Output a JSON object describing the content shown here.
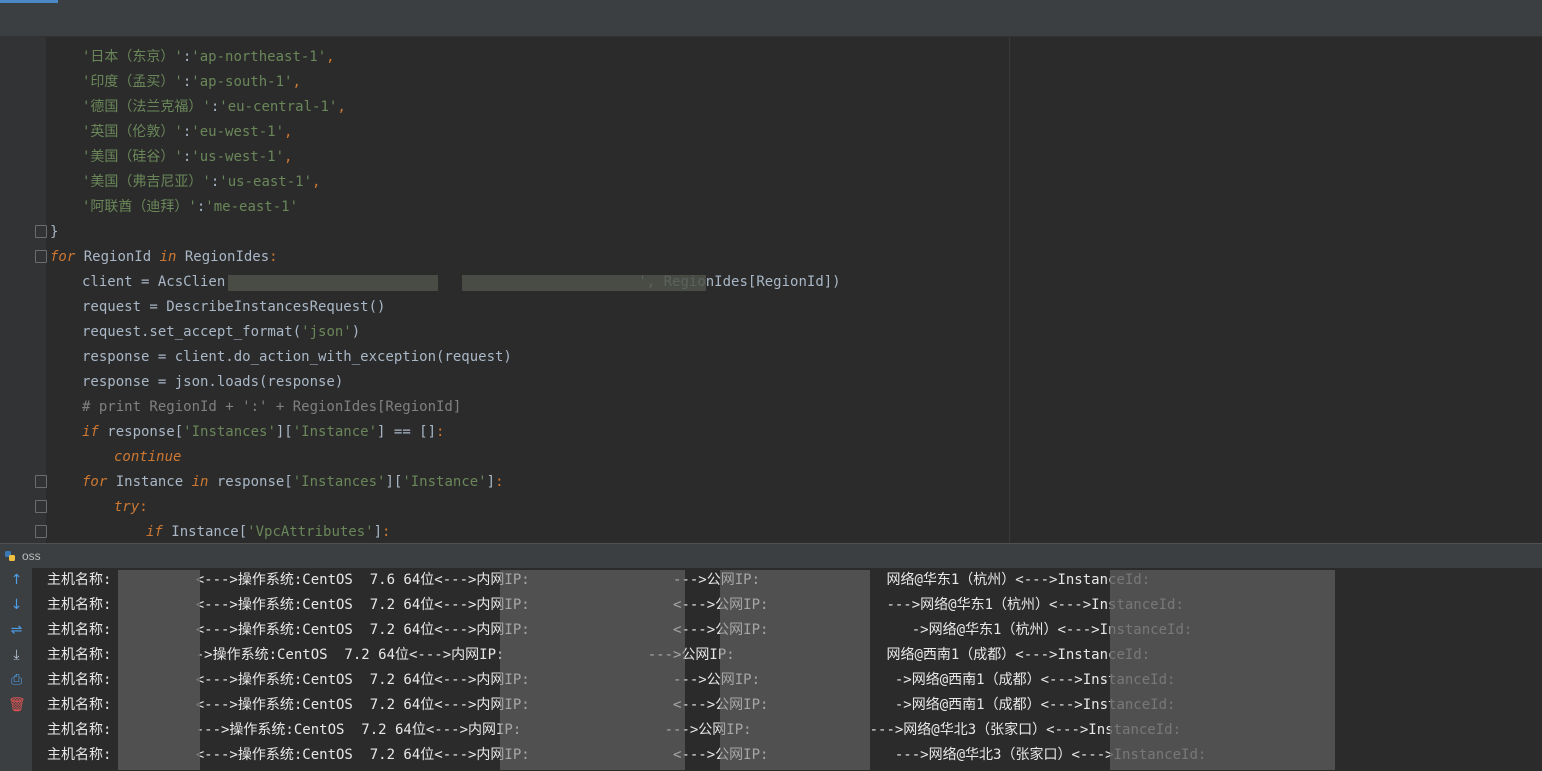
{
  "editor": {
    "lines": [
      {
        "indent": 2,
        "parts": [
          {
            "t": "'日本（东京）'",
            "c": "str"
          },
          {
            "t": ":",
            "c": ""
          },
          {
            "t": "'ap-northeast-1'",
            "c": "str"
          },
          {
            "t": ",",
            "c": "kw2"
          }
        ]
      },
      {
        "indent": 2,
        "parts": [
          {
            "t": "'印度（孟买）'",
            "c": "str"
          },
          {
            "t": ":",
            "c": ""
          },
          {
            "t": "'ap-south-1'",
            "c": "str"
          },
          {
            "t": ",",
            "c": "kw2"
          }
        ]
      },
      {
        "indent": 2,
        "parts": [
          {
            "t": "'德国（法兰克福）'",
            "c": "str"
          },
          {
            "t": ":",
            "c": ""
          },
          {
            "t": "'eu-central-1'",
            "c": "str"
          },
          {
            "t": ",",
            "c": "kw2"
          }
        ]
      },
      {
        "indent": 2,
        "parts": [
          {
            "t": "'英国（伦敦）'",
            "c": "str"
          },
          {
            "t": ":",
            "c": ""
          },
          {
            "t": "'eu-west-1'",
            "c": "str"
          },
          {
            "t": ",",
            "c": "kw2"
          }
        ]
      },
      {
        "indent": 2,
        "parts": [
          {
            "t": "'美国（硅谷）'",
            "c": "str"
          },
          {
            "t": ":",
            "c": ""
          },
          {
            "t": "'us-west-1'",
            "c": "str"
          },
          {
            "t": ",",
            "c": "kw2"
          }
        ]
      },
      {
        "indent": 2,
        "parts": [
          {
            "t": "'美国（弗吉尼亚）'",
            "c": "str"
          },
          {
            "t": ":",
            "c": ""
          },
          {
            "t": "'us-east-1'",
            "c": "str"
          },
          {
            "t": ",",
            "c": "kw2"
          }
        ]
      },
      {
        "indent": 2,
        "parts": [
          {
            "t": "'阿联酋（迪拜）'",
            "c": "str"
          },
          {
            "t": ":",
            "c": ""
          },
          {
            "t": "'me-east-1'",
            "c": "str"
          }
        ]
      },
      {
        "indent": 0,
        "parts": [
          {
            "t": "}",
            "c": ""
          }
        ]
      },
      {
        "indent": 0,
        "parts": [
          {
            "t": "for",
            "c": "kw"
          },
          {
            "t": " RegionId ",
            "c": ""
          },
          {
            "t": "in",
            "c": "kw"
          },
          {
            "t": " RegionIdes",
            "c": ""
          },
          {
            "t": ":",
            "c": "kw2"
          }
        ]
      },
      {
        "indent": 2,
        "parts": [
          {
            "t": "client = AcsClien",
            "c": ""
          },
          {
            "t": "                                                 ",
            "c": ""
          },
          {
            "t": "', RegionIdes[RegionId])",
            "c": ""
          }
        ]
      },
      {
        "indent": 2,
        "parts": [
          {
            "t": "request = DescribeInstancesRequest()",
            "c": ""
          }
        ]
      },
      {
        "indent": 2,
        "parts": [
          {
            "t": "request.set_accept_format(",
            "c": ""
          },
          {
            "t": "'json'",
            "c": "str"
          },
          {
            "t": ")",
            "c": ""
          }
        ]
      },
      {
        "indent": 2,
        "parts": [
          {
            "t": "response = client.do_action_with_exception(request)",
            "c": ""
          }
        ]
      },
      {
        "indent": 2,
        "parts": [
          {
            "t": "response = json.loads(response)",
            "c": ""
          }
        ]
      },
      {
        "indent": 2,
        "parts": [
          {
            "t": "# print RegionId + ':' + RegionIdes[RegionId]",
            "c": "cmt"
          }
        ]
      },
      {
        "indent": 2,
        "parts": [
          {
            "t": "if",
            "c": "kw"
          },
          {
            "t": " response[",
            "c": ""
          },
          {
            "t": "'Instances'",
            "c": "str"
          },
          {
            "t": "][",
            "c": ""
          },
          {
            "t": "'Instance'",
            "c": "str"
          },
          {
            "t": "] == []",
            "c": ""
          },
          {
            "t": ":",
            "c": "kw2"
          }
        ]
      },
      {
        "indent": 4,
        "parts": [
          {
            "t": "continue",
            "c": "kw"
          }
        ]
      },
      {
        "indent": 2,
        "parts": [
          {
            "t": "for",
            "c": "kw"
          },
          {
            "t": " Instance ",
            "c": ""
          },
          {
            "t": "in",
            "c": "kw"
          },
          {
            "t": " response[",
            "c": ""
          },
          {
            "t": "'Instances'",
            "c": "str"
          },
          {
            "t": "][",
            "c": ""
          },
          {
            "t": "'Instance'",
            "c": "str"
          },
          {
            "t": "]",
            "c": ""
          },
          {
            "t": ":",
            "c": "kw2"
          }
        ]
      },
      {
        "indent": 4,
        "parts": [
          {
            "t": "try",
            "c": "kw"
          },
          {
            "t": ":",
            "c": "kw2"
          }
        ]
      },
      {
        "indent": 6,
        "parts": [
          {
            "t": "if",
            "c": "kw"
          },
          {
            "t": " Instance[",
            "c": ""
          },
          {
            "t": "'VpcAttributes'",
            "c": "str"
          },
          {
            "t": "]",
            "c": ""
          },
          {
            "t": ":",
            "c": "kw2"
          }
        ]
      }
    ]
  },
  "console": {
    "title": "oss",
    "tools": [
      "up-arrow-icon",
      "down-arrow-icon",
      "soft-wrap-icon",
      "scroll-to-end-icon",
      "print-icon",
      "trash-icon"
    ],
    "lines": [
      "主机名称:          <--->操作系统:CentOS  7.6 64位<--->内网IP:                 --->公网IP:               网络@华东1（杭州）<--->InstanceId:",
      "主机名称:          <--->操作系统:CentOS  7.2 64位<--->内网IP:                 <--->公网IP:              --->网络@华东1（杭州）<--->InstanceId:",
      "主机名称:          <--->操作系统:CentOS  7.2 64位<--->内网IP:                 <--->公网IP:                 ->网络@华东1（杭州）<--->InstanceId:",
      "主机名称:          ->操作系统:CentOS  7.2 64位<--->内网IP:                 --->公网IP:                  网络@西南1（成都）<--->InstanceId:",
      "主机名称:          <--->操作系统:CentOS  7.2 64位<--->内网IP:                 --->公网IP:                ->网络@西南1（成都）<--->InstanceId:",
      "主机名称:          <--->操作系统:CentOS  7.2 64位<--->内网IP:                 <--->公网IP:               ->网络@西南1（成都）<--->InstanceId:",
      "主机名称:          --->操作系统:CentOS  7.2 64位<--->内网IP:                 --->公网IP:              --->网络@华北3（张家口）<--->InstanceId:",
      "主机名称:          <--->操作系统:CentOS  7.2 64位<--->内网IP:                 <--->公网IP:               --->网络@华北3（张家口）<--->InstanceId:"
    ]
  }
}
